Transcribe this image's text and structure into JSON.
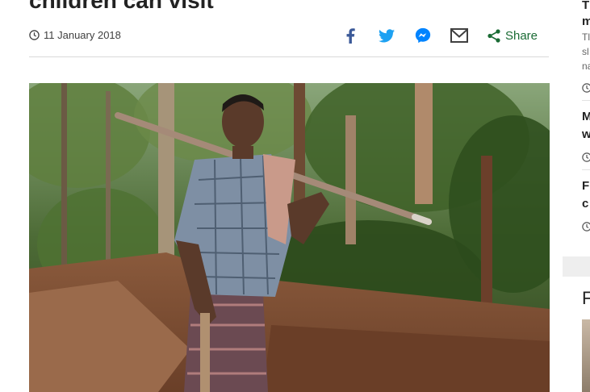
{
  "article": {
    "headline": "children can visit",
    "date": "11 January 2018",
    "share_label": "Share"
  },
  "icons": {
    "facebook": "facebook-icon",
    "twitter": "twitter-icon",
    "messenger": "messenger-icon",
    "email": "email-icon",
    "share": "share-icon",
    "clock": "clock-icon"
  },
  "colors": {
    "facebook": "#3b5998",
    "twitter": "#1da1f2",
    "messenger": "#0084ff",
    "email": "#404040",
    "share": "#1a6b34"
  },
  "sidebar": {
    "items": [
      {
        "title_fragment": "T",
        "title_line2": "m",
        "summary": [
          "Tl",
          "sl",
          "na"
        ]
      },
      {
        "title_fragment": "M",
        "title_line2": "w"
      },
      {
        "title_fragment": "F",
        "title_line2": "c"
      }
    ],
    "bottom_heading": "F"
  }
}
